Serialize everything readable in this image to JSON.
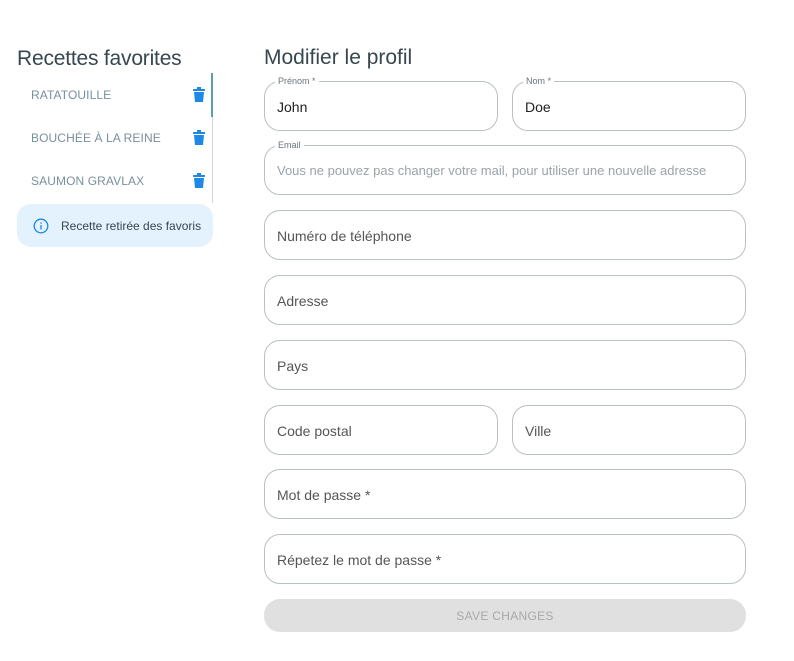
{
  "sidebar": {
    "title": "Recettes favorites",
    "items": [
      {
        "label": "RATATOUILLE",
        "icon": "trash-icon"
      },
      {
        "label": "BOUCHÉE À LA REINE",
        "icon": "trash-icon"
      },
      {
        "label": "SAUMON GRAVLAX",
        "icon": "trash-icon"
      }
    ],
    "toast": {
      "icon": "info-icon",
      "message": "Recette retirée des favoris"
    }
  },
  "profile": {
    "title": "Modifier le profil",
    "fields": {
      "first_name": {
        "label": "Prénom *",
        "value": "John"
      },
      "last_name": {
        "label": "Nom *",
        "value": "Doe"
      },
      "email": {
        "label": "Email",
        "placeholder": "Vous ne pouvez pas changer votre mail, pour utiliser une nouvelle adresse"
      },
      "phone": {
        "placeholder": "Numéro de téléphone"
      },
      "address": {
        "placeholder": "Adresse"
      },
      "country": {
        "placeholder": "Pays"
      },
      "postal_code": {
        "placeholder": "Code postal"
      },
      "city": {
        "placeholder": "Ville"
      },
      "password": {
        "placeholder": "Mot de passe *"
      },
      "password_repeat": {
        "placeholder": "Répetez le mot de passe *"
      }
    },
    "save_label": "Save changes"
  },
  "colors": {
    "trash": "#1e88e5",
    "toast_bg": "#e3f2fd",
    "toast_icon": "#1e88e5",
    "scroll_thumb": "#5aa0b0",
    "field_border": "#b9c0c4",
    "button_disabled_bg": "#e0e0e0"
  }
}
